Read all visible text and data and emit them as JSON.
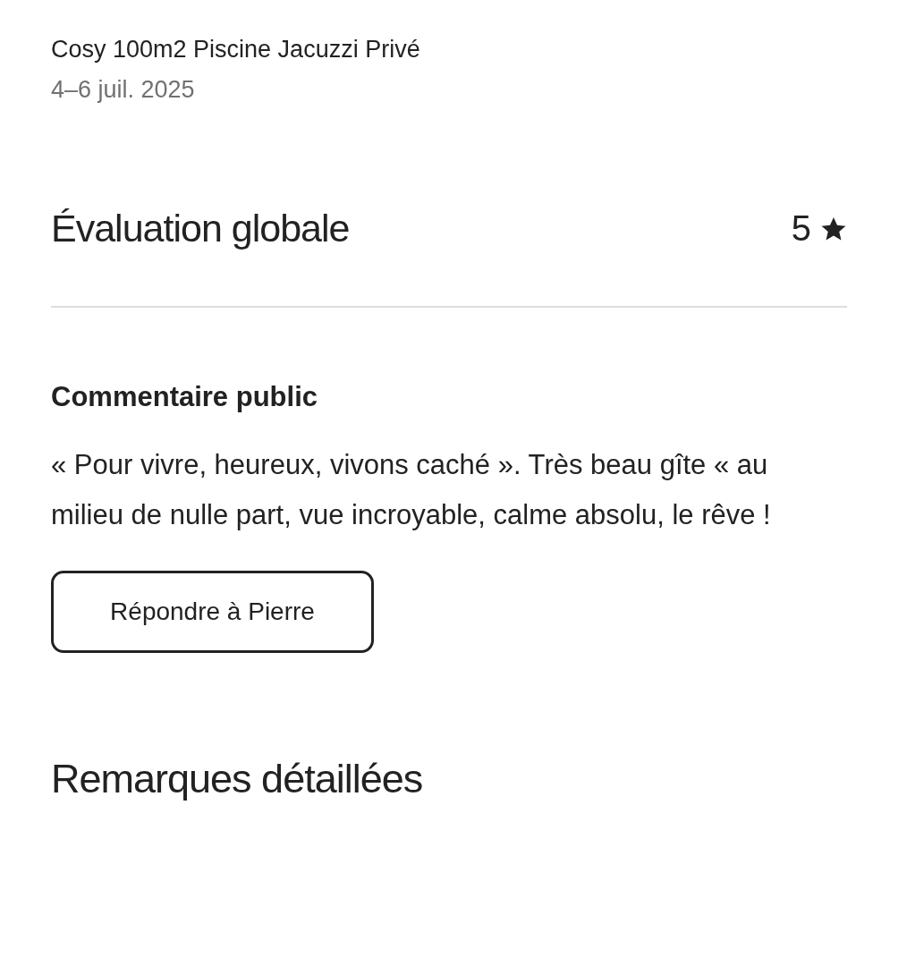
{
  "listing": {
    "name": "Cosy 100m2 Piscine Jacuzzi Privé",
    "dates": "4–6 juil. 2025"
  },
  "overall_rating": {
    "title": "Évaluation globale",
    "value": "5"
  },
  "public_comment": {
    "title": "Commentaire public",
    "text": "« Pour vivre, heureux, vivons caché ». Très beau gîte « au milieu de nulle part, vue incroyable, calme absolu, le rêve !"
  },
  "reply_button": {
    "label": "Répondre à Pierre"
  },
  "detailed_remarks": {
    "title": "Remarques détaillées"
  }
}
